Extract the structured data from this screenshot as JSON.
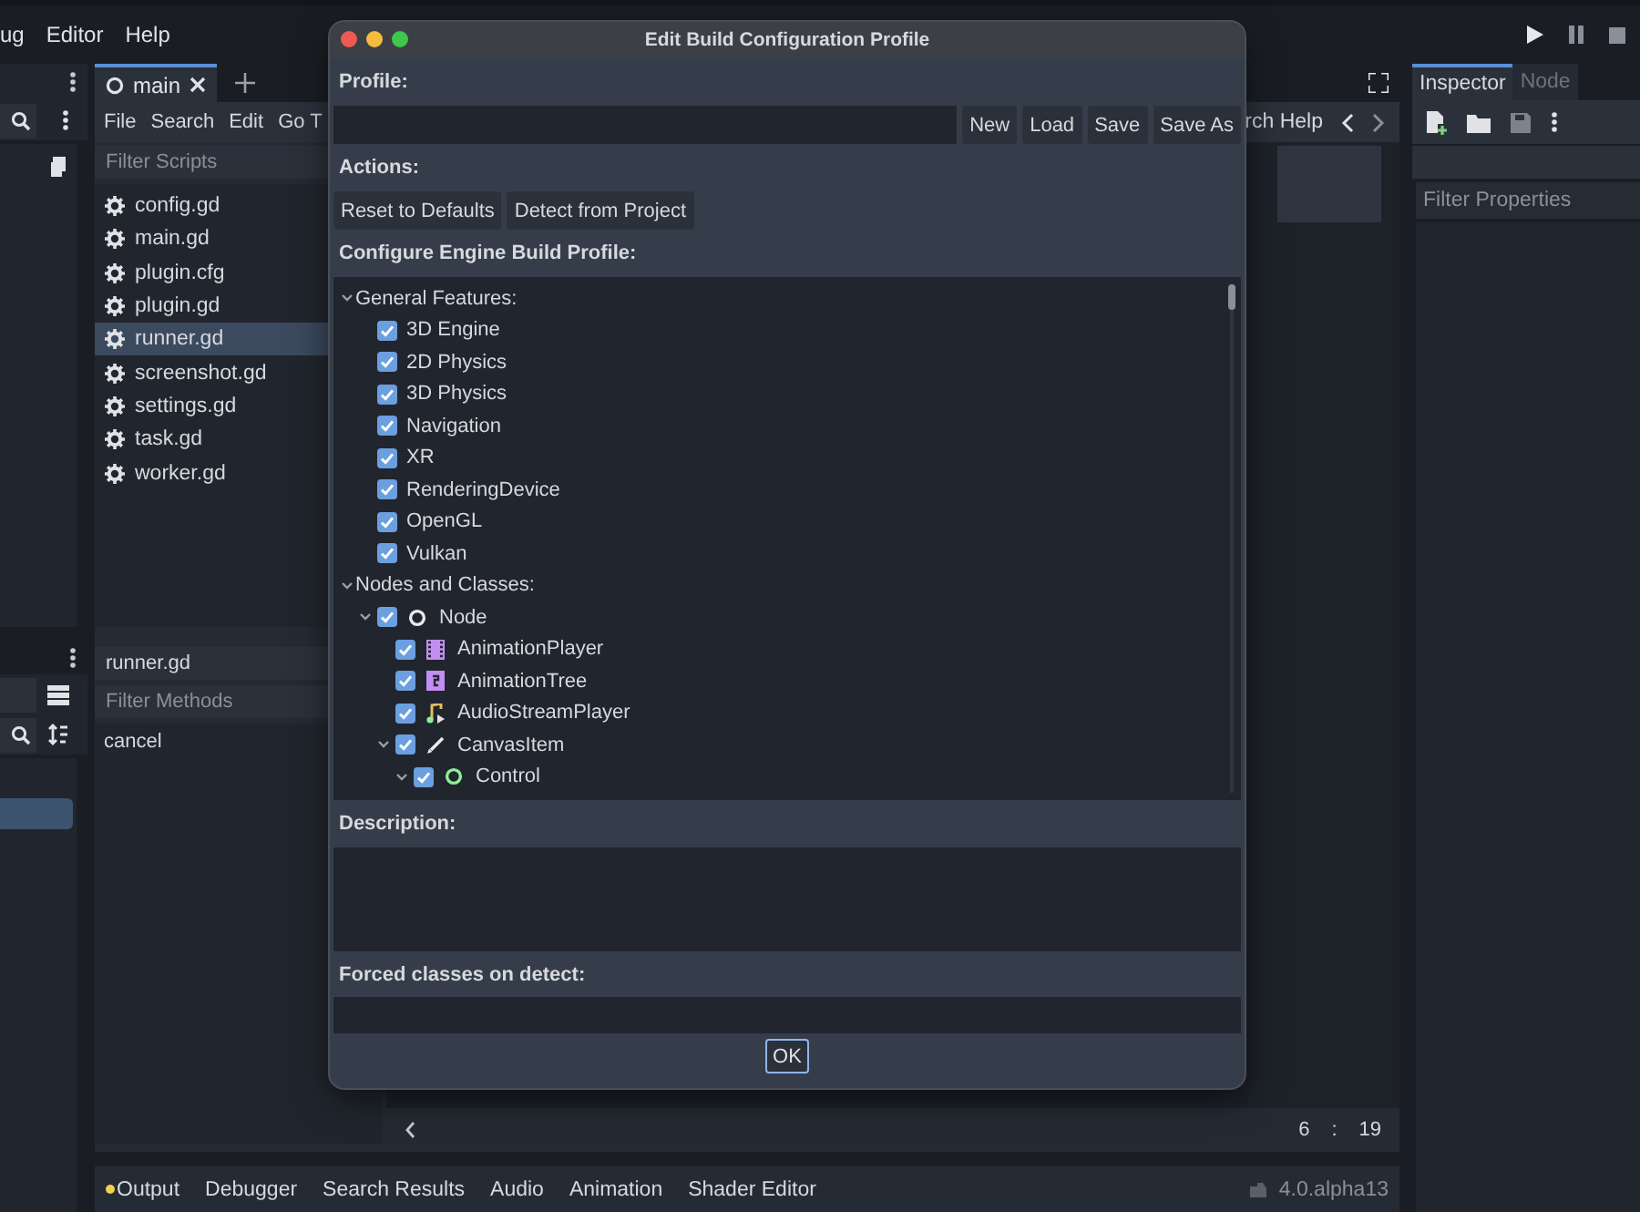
{
  "menu_bar": {
    "items": [
      "ug",
      "Editor",
      "Help"
    ]
  },
  "script_editor": {
    "tabs": [
      {
        "label": "main",
        "selected": true
      }
    ],
    "menu": [
      "File",
      "Search",
      "Edit",
      "Go T"
    ],
    "help_partial": "rch Help",
    "filter_placeholder": "Filter Scripts",
    "scripts": [
      {
        "name": "config.gd",
        "selected": false
      },
      {
        "name": "main.gd",
        "selected": false
      },
      {
        "name": "plugin.cfg",
        "selected": false
      },
      {
        "name": "plugin.gd",
        "selected": false
      },
      {
        "name": "runner.gd",
        "selected": true
      },
      {
        "name": "screenshot.gd",
        "selected": false
      },
      {
        "name": "settings.gd",
        "selected": false
      },
      {
        "name": "task.gd",
        "selected": false
      },
      {
        "name": "worker.gd",
        "selected": false
      }
    ],
    "current_script": "runner.gd",
    "methods_filter_placeholder": "Filter Methods",
    "methods": [
      "cancel"
    ],
    "caret_line": "6",
    "caret_separator": ":",
    "caret_column": "19"
  },
  "bottom_panel": {
    "tabs": [
      {
        "label": "Output",
        "dot": true
      },
      {
        "label": "Debugger",
        "dot": false
      },
      {
        "label": "Search Results",
        "dot": false
      },
      {
        "label": "Audio",
        "dot": false
      },
      {
        "label": "Animation",
        "dot": false
      },
      {
        "label": "Shader Editor",
        "dot": false
      }
    ],
    "version": "4.0.alpha13"
  },
  "inspector": {
    "tabs": [
      {
        "label": "Inspector",
        "selected": true
      },
      {
        "label": "Node",
        "selected": false
      }
    ],
    "filter_placeholder": "Filter Properties"
  },
  "dialog": {
    "title": "Edit Build Configuration Profile",
    "profile_label": "Profile:",
    "profile_buttons": [
      "New",
      "Load",
      "Save",
      "Save As"
    ],
    "actions_label": "Actions:",
    "action_buttons": [
      "Reset to Defaults",
      "Detect from Project"
    ],
    "configure_label": "Configure Engine Build Profile:",
    "tree": [
      {
        "label": "General Features:",
        "kind": "category",
        "expanded": true,
        "children": [
          {
            "label": "3D Engine",
            "kind": "feature",
            "checked": true
          },
          {
            "label": "2D Physics",
            "kind": "feature",
            "checked": true
          },
          {
            "label": "3D Physics",
            "kind": "feature",
            "checked": true
          },
          {
            "label": "Navigation",
            "kind": "feature",
            "checked": true
          },
          {
            "label": "XR",
            "kind": "feature",
            "checked": true
          },
          {
            "label": "RenderingDevice",
            "kind": "feature",
            "checked": true
          },
          {
            "label": "OpenGL",
            "kind": "feature",
            "checked": true
          },
          {
            "label": "Vulkan",
            "kind": "feature",
            "checked": true
          }
        ]
      },
      {
        "label": "Nodes and Classes:",
        "kind": "category",
        "expanded": true,
        "children": [
          {
            "label": "Node",
            "kind": "node",
            "checked": true,
            "expanded": true,
            "children": [
              {
                "label": "AnimationPlayer",
                "kind": "animation_player",
                "checked": true
              },
              {
                "label": "AnimationTree",
                "kind": "animation_tree",
                "checked": true
              },
              {
                "label": "AudioStreamPlayer",
                "kind": "audio",
                "checked": true
              },
              {
                "label": "CanvasItem",
                "kind": "canvas_item",
                "checked": true,
                "expanded": true,
                "children": [
                  {
                    "label": "Control",
                    "kind": "control",
                    "checked": true,
                    "expanded": true
                  }
                ]
              }
            ]
          }
        ]
      }
    ],
    "description_label": "Description:",
    "forced_label": "Forced classes on detect:",
    "ok_button": "OK"
  }
}
